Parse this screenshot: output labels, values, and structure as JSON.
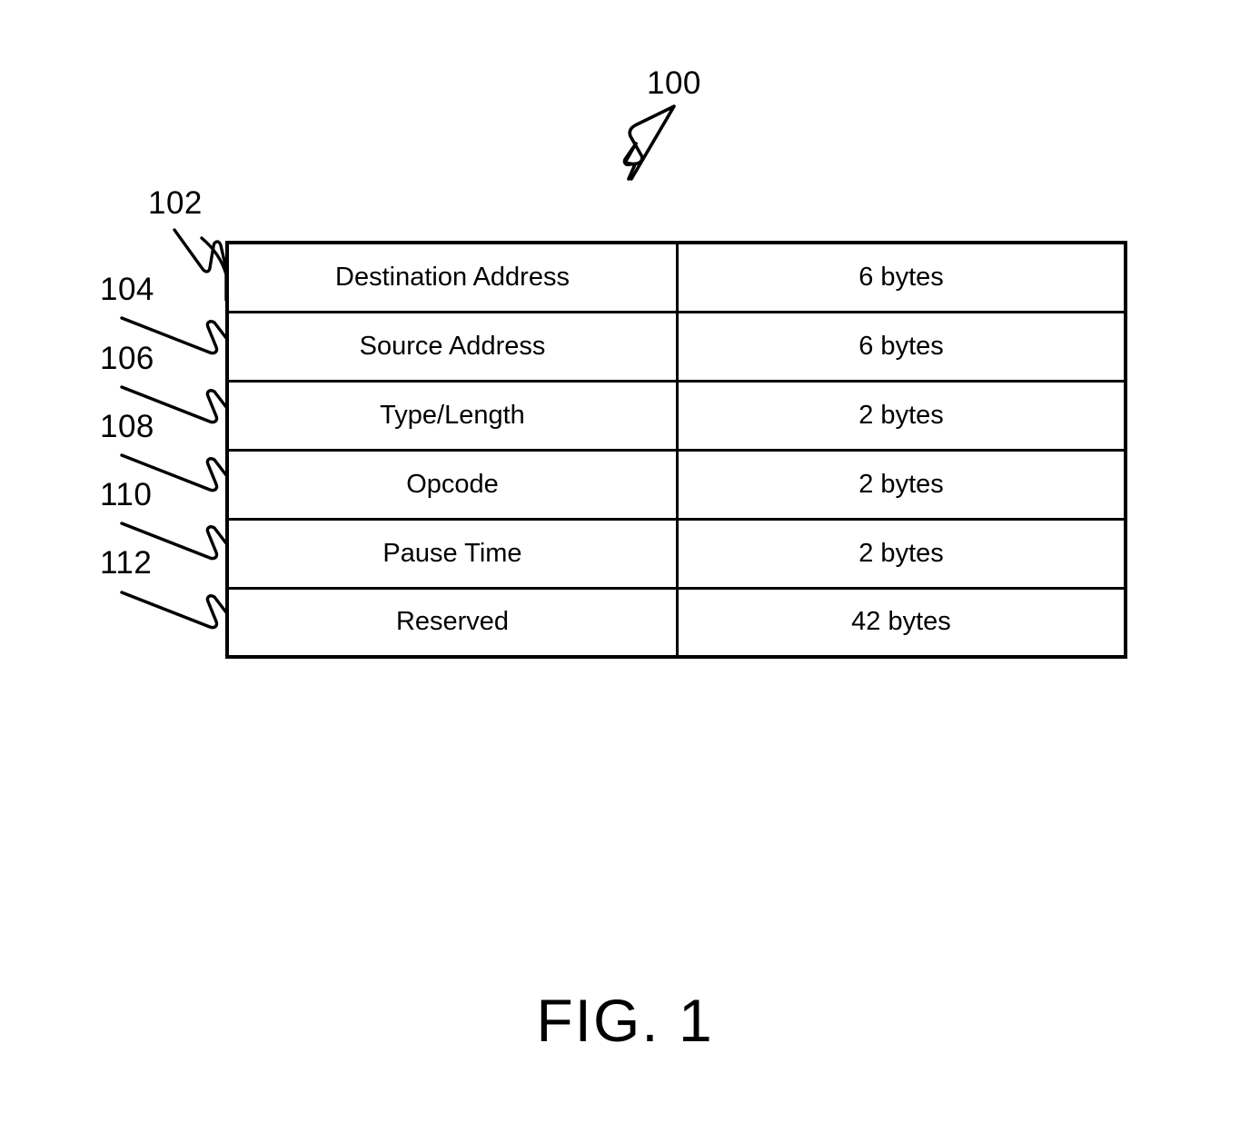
{
  "figure": {
    "caption": "FIG. 1",
    "main_ref": "100"
  },
  "reference_numerals": [
    {
      "id": "100",
      "label": "100",
      "target": "pause-frame-overall"
    },
    {
      "id": "102",
      "label": "102",
      "target": "destination-address-row"
    },
    {
      "id": "104",
      "label": "104",
      "target": "source-address-row"
    },
    {
      "id": "106",
      "label": "106",
      "target": "type-length-row"
    },
    {
      "id": "108",
      "label": "108",
      "target": "opcode-row"
    },
    {
      "id": "110",
      "label": "110",
      "target": "pause-time-row"
    },
    {
      "id": "112",
      "label": "112",
      "target": "reserved-row"
    }
  ],
  "table": {
    "rows": [
      {
        "field": "Destination Address",
        "size": "6 bytes"
      },
      {
        "field": "Source Address",
        "size": "6 bytes"
      },
      {
        "field": "Type/Length",
        "size": "2 bytes"
      },
      {
        "field": "Opcode",
        "size": "2 bytes"
      },
      {
        "field": "Pause Time",
        "size": "2 bytes"
      },
      {
        "field": "Reserved",
        "size": "42 bytes"
      }
    ]
  },
  "colors": {
    "ink": "#000000",
    "paper": "#ffffff"
  }
}
